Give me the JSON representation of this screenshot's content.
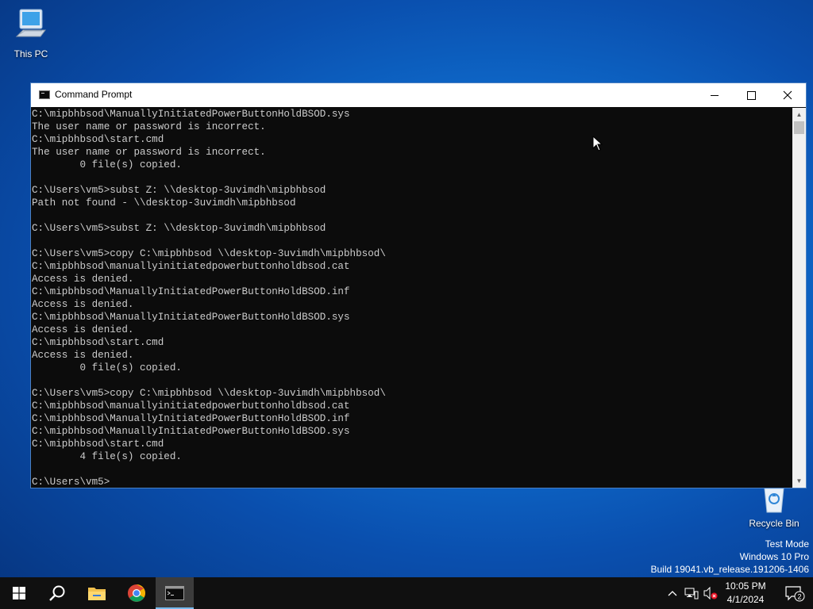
{
  "desktop": {
    "icons": [
      {
        "label": "This PC",
        "icon": "computer-icon"
      },
      {
        "label": "Recycle Bin",
        "icon": "recycle-bin-icon"
      }
    ],
    "watermark": [
      "Test Mode",
      "Windows 10 Pro",
      "Build 19041.vb_release.191206-1406"
    ]
  },
  "window": {
    "title": "Command Prompt",
    "icon": "cmd-icon",
    "controls": {
      "minimize": "minimize-icon",
      "maximize": "maximize-icon",
      "close": "close-icon"
    },
    "console_lines": [
      "C:\\mipbhbsod\\ManuallyInitiatedPowerButtonHoldBSOD.sys",
      "The user name or password is incorrect.",
      "C:\\mipbhbsod\\start.cmd",
      "The user name or password is incorrect.",
      "        0 file(s) copied.",
      "",
      "C:\\Users\\vm5>subst Z: \\\\desktop-3uvimdh\\mipbhbsod",
      "Path not found - \\\\desktop-3uvimdh\\mipbhbsod",
      "",
      "C:\\Users\\vm5>subst Z: \\\\desktop-3uvimdh\\mipbhbsod",
      "",
      "C:\\Users\\vm5>copy C:\\mipbhbsod \\\\desktop-3uvimdh\\mipbhbsod\\",
      "C:\\mipbhbsod\\manuallyinitiatedpowerbuttonholdbsod.cat",
      "Access is denied.",
      "C:\\mipbhbsod\\ManuallyInitiatedPowerButtonHoldBSOD.inf",
      "Access is denied.",
      "C:\\mipbhbsod\\ManuallyInitiatedPowerButtonHoldBSOD.sys",
      "Access is denied.",
      "C:\\mipbhbsod\\start.cmd",
      "Access is denied.",
      "        0 file(s) copied.",
      "",
      "C:\\Users\\vm5>copy C:\\mipbhbsod \\\\desktop-3uvimdh\\mipbhbsod\\",
      "C:\\mipbhbsod\\manuallyinitiatedpowerbuttonholdbsod.cat",
      "C:\\mipbhbsod\\ManuallyInitiatedPowerButtonHoldBSOD.inf",
      "C:\\mipbhbsod\\ManuallyInitiatedPowerButtonHoldBSOD.sys",
      "C:\\mipbhbsod\\start.cmd",
      "        4 file(s) copied.",
      "",
      "C:\\Users\\vm5>"
    ],
    "colors": {
      "console_bg": "#0c0c0c",
      "console_text": "#cccccc"
    }
  },
  "taskbar": {
    "items": [
      "start-icon",
      "search-icon",
      "file-explorer-icon",
      "chrome-icon",
      "command-prompt-icon"
    ],
    "tray": {
      "time": "10:05 PM",
      "date": "4/1/2024",
      "notification_count": "2"
    }
  }
}
